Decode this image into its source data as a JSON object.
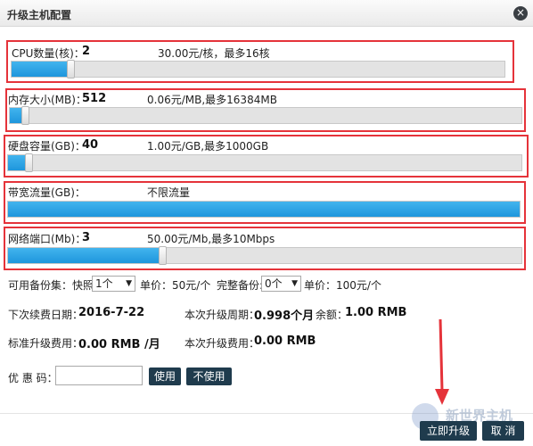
{
  "dialog": {
    "title": "升级主机配置",
    "close_glyph": "×"
  },
  "sliders": [
    {
      "label": "CPU数量(核)：",
      "value": "2",
      "price": "30.00元/核，最多16核",
      "level_fraction": 0.12
    },
    {
      "label": "内存大小(MB)：",
      "value": "512",
      "price": "0.06元/MB,最多16384MB",
      "level_fraction": 0.03
    },
    {
      "label": "硬盘容量(GB)：",
      "value": "40",
      "price": "1.00元/GB,最多1000GB",
      "level_fraction": 0.04
    },
    {
      "label": "带宽流量(GB)：",
      "value": "",
      "price": "不限流量",
      "level_fraction": 1.0
    },
    {
      "label": "网络端口(Mb)：",
      "value": "3",
      "price": "50.00元/Mb,最多10Mbps",
      "level_fraction": 0.3
    }
  ],
  "backup": {
    "label": "可用备份集：快照:",
    "snapshot_select": "1个",
    "snapshot_price": "单价：50元/个",
    "full_label": "完整备份:",
    "full_select": "0个",
    "full_price": "单价：100元/个"
  },
  "renewal": {
    "date_label": "下次续费日期：",
    "date_value": "2016-7-22",
    "period_label": "本次升级周期：",
    "period_value": "0.998个月",
    "balance_label": "余额：",
    "balance_value": "1.00 RMB"
  },
  "fees": {
    "standard_label": "标准升级费用：",
    "standard_value": "0.00 RMB /月",
    "current_label": "本次升级费用：",
    "current_value": "0.00 RMB"
  },
  "coupon": {
    "label": "优 惠 码：",
    "input_value": "",
    "use_button": "使用",
    "not_use_button": "不使用"
  },
  "footer": {
    "upgrade_button": "立即升级",
    "cancel_button": "取 消"
  },
  "watermark": "新世界主机",
  "colors": {
    "accent_fill": "#1e96dc",
    "highlight_border": "#e5333a",
    "button_bg": "#1f3b4d"
  }
}
